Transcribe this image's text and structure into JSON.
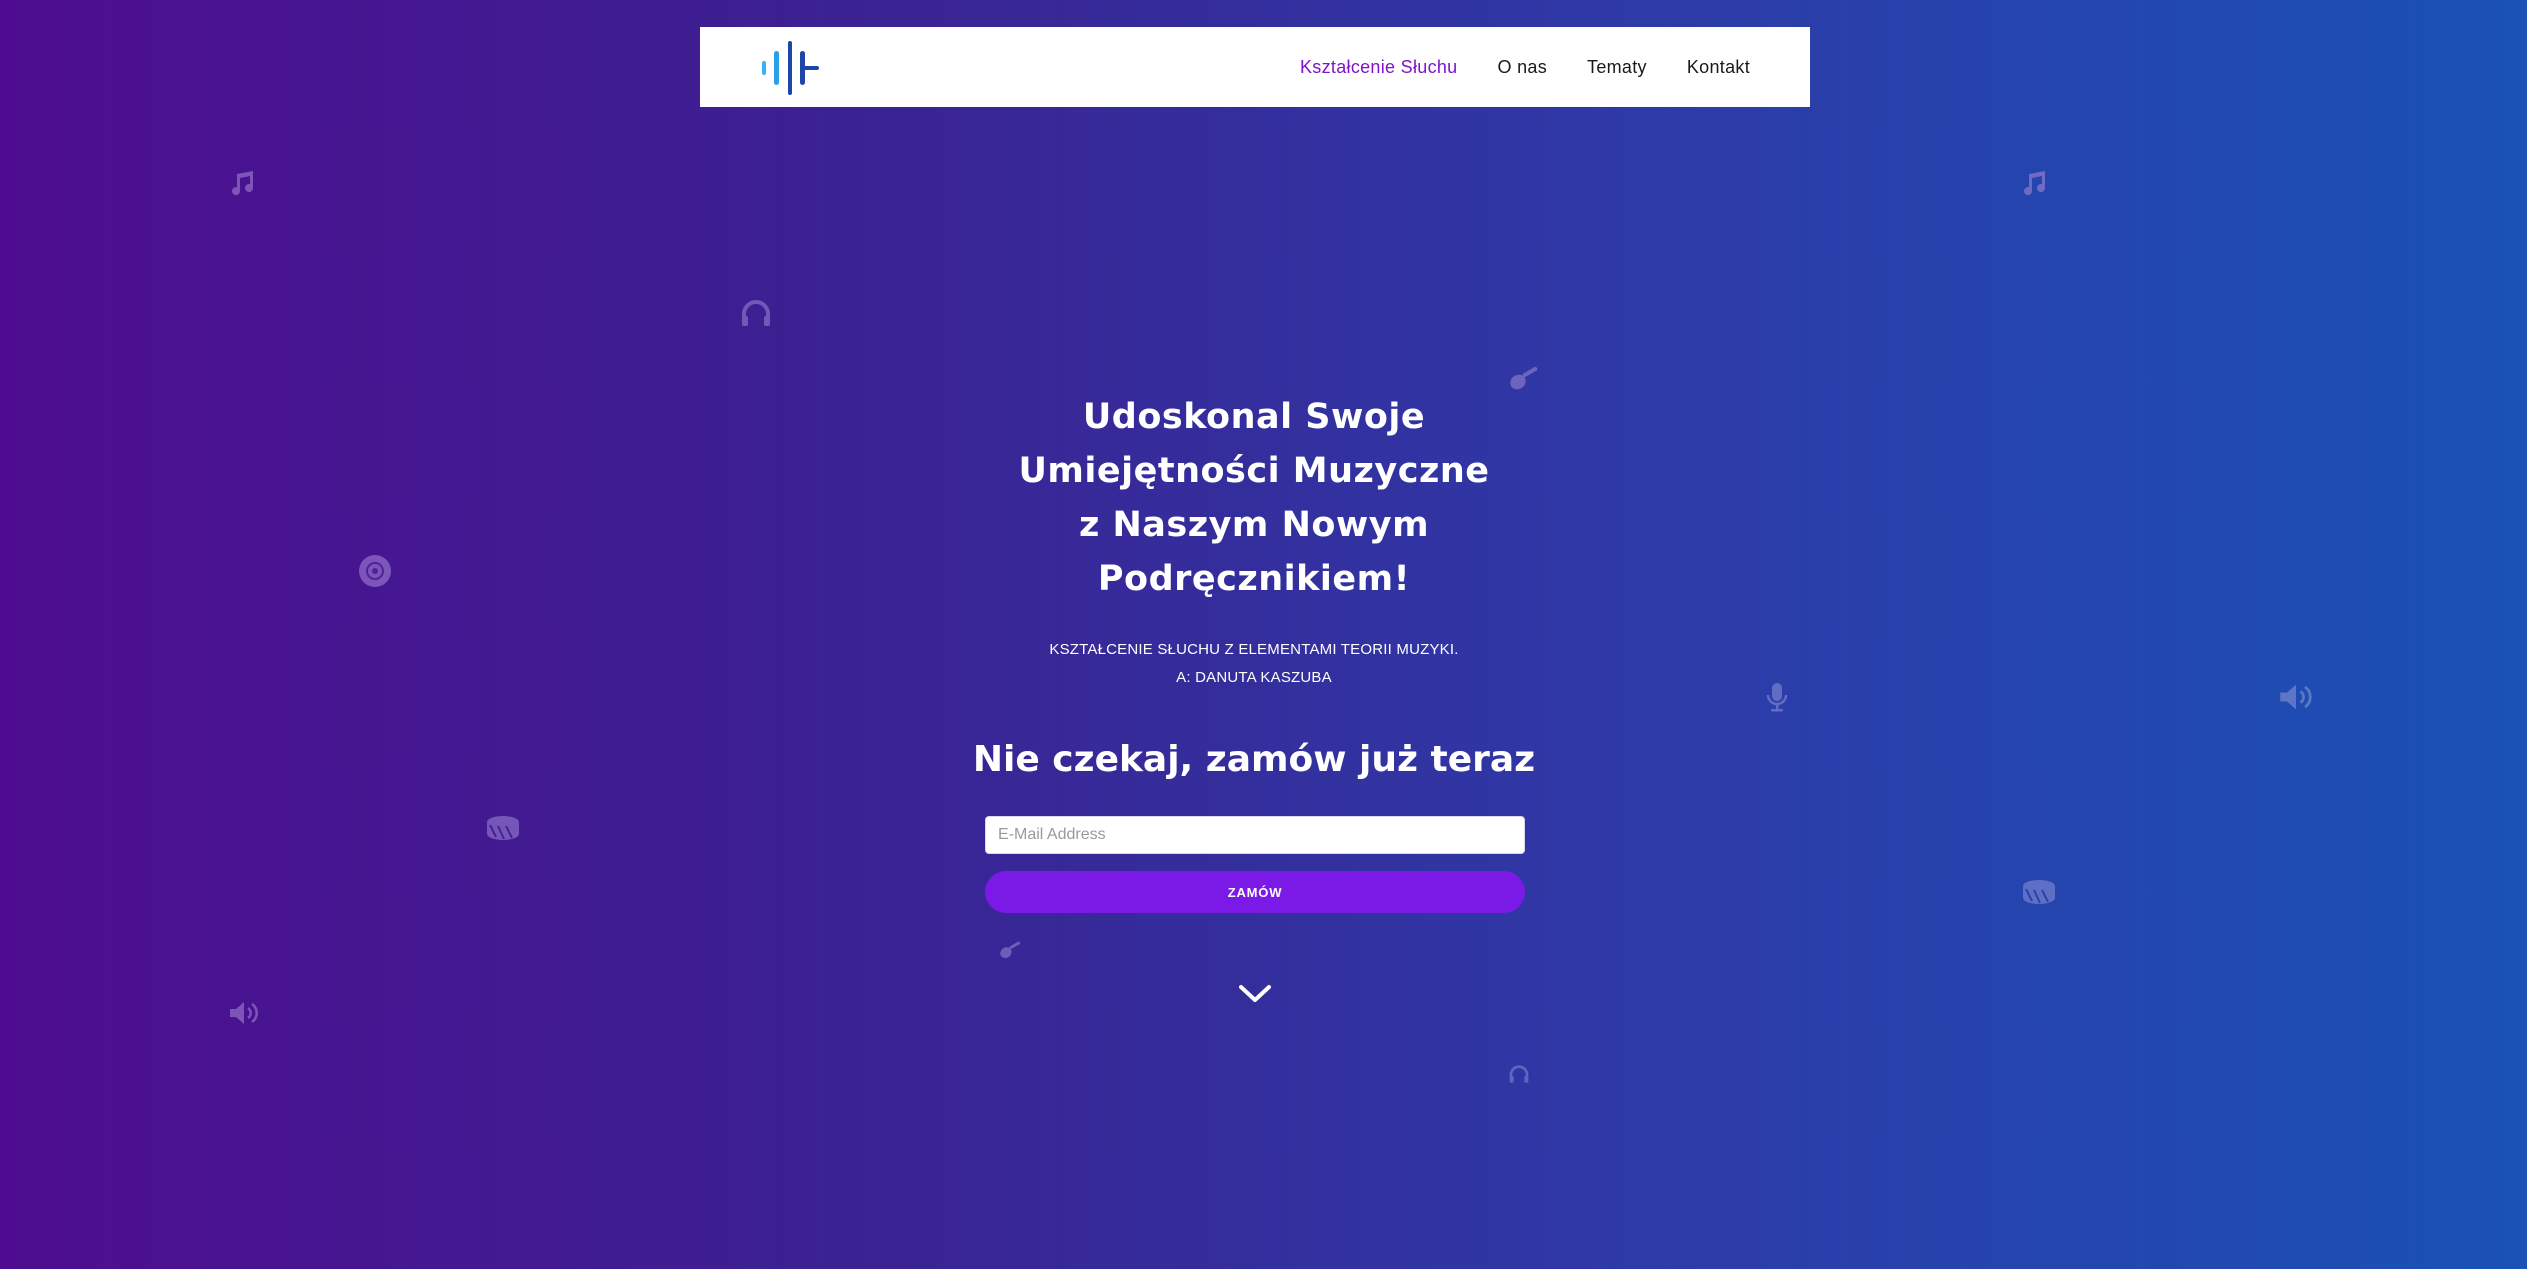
{
  "navbar": {
    "logo_icon": "soundwave-logo-icon",
    "links": [
      {
        "label": "Kształcenie Słuchu",
        "active": true
      },
      {
        "label": "O nas",
        "active": false
      },
      {
        "label": "Tematy",
        "active": false
      },
      {
        "label": "Kontakt",
        "active": false
      }
    ]
  },
  "hero": {
    "title_lines": [
      "Udoskonal Swoje",
      "Umiejętności Muzyczne",
      "z Naszym Nowym",
      "Podręcznikiem!"
    ],
    "subtitle_lines": [
      "KSZTAŁCENIE SŁUCHU Z ELEMENTAMI TEORII MUZYKI.",
      "A: DANUTA KASZUBA"
    ],
    "cta_heading": "Nie czekaj, zamów już teraz",
    "email_placeholder": "E-Mail Address",
    "email_value": "",
    "button_label": "ZAMÓW",
    "scroll_icon": "chevron-down-icon"
  },
  "decorative_icons": [
    "music-note-icon",
    "headphones-icon",
    "guitar-icon",
    "disc-icon",
    "drum-icon",
    "volume-icon",
    "microphone-icon"
  ],
  "colors": {
    "accent": "#7b1ae6",
    "active_link": "#7c15c9",
    "gradient_left": "#4e0d90",
    "gradient_right": "#1a52b5"
  }
}
